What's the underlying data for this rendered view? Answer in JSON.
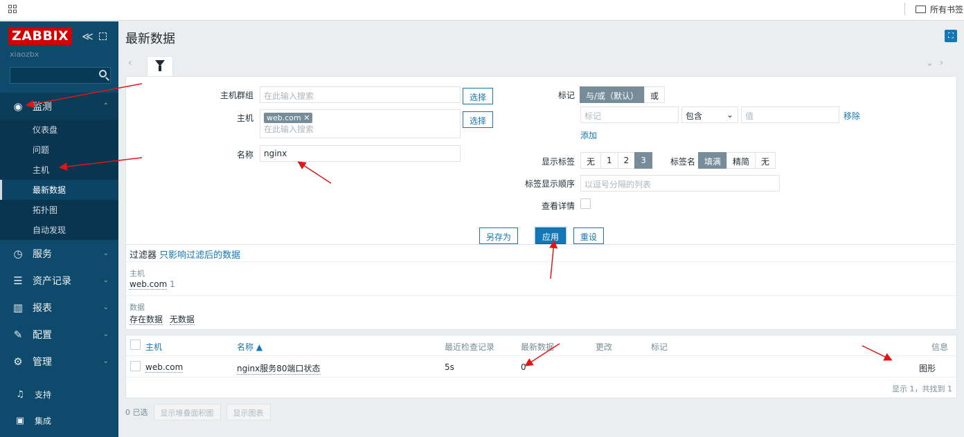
{
  "browser": {
    "bookmarks_label": "所有书签"
  },
  "sidebar": {
    "logo": "ZABBIX",
    "collapse": "≪",
    "server_name": "xiaozbx",
    "search_placeholder": "",
    "menu": [
      {
        "label": "监测",
        "icon": "eye-icon",
        "open": true
      },
      {
        "label": "服务",
        "icon": "clock-icon"
      },
      {
        "label": "资产记录",
        "icon": "list-icon"
      },
      {
        "label": "报表",
        "icon": "chart-icon"
      },
      {
        "label": "配置",
        "icon": "wrench-icon"
      },
      {
        "label": "管理",
        "icon": "gear-icon"
      }
    ],
    "submenu": [
      {
        "label": "仪表盘"
      },
      {
        "label": "问题"
      },
      {
        "label": "主机"
      },
      {
        "label": "最新数据",
        "active": true
      },
      {
        "label": "拓扑图"
      },
      {
        "label": "自动发现"
      }
    ],
    "bottom": [
      {
        "label": "支持",
        "icon": "headset-icon"
      },
      {
        "label": "集成",
        "icon": "z-icon"
      }
    ]
  },
  "page": {
    "title": "最新数据"
  },
  "filter": {
    "host_group_label": "主机群组",
    "host_group_placeholder": "在此输入搜索",
    "select_label": "选择",
    "host_label": "主机",
    "host_tag": "web.com",
    "host_placeholder": "在此输入搜索",
    "name_label": "名称",
    "name_value": "nginx",
    "tags_label": "标记",
    "and_or": "与/或（默认）",
    "or": "或",
    "tag_placeholder": "标记",
    "contains": "包含",
    "value_placeholder": "值",
    "remove": "移除",
    "add": "添加",
    "show_tags_label": "显示标签",
    "show_tags_options": [
      "无",
      "1",
      "2",
      "3"
    ],
    "tag_name_label": "标签名",
    "tag_name_options": [
      "填满",
      "精简",
      "无"
    ],
    "tag_priority_label": "标签显示顺序",
    "tag_priority_placeholder": "以逗号分隔的列表",
    "show_details_label": "查看详情",
    "save_as": "另存为",
    "apply": "应用",
    "reset": "重设"
  },
  "filter_info": {
    "title": "过滤器",
    "subtitle": "只影响过滤后的数据",
    "host_section": "主机",
    "host_value": "web.com",
    "host_count": "1",
    "data_section": "数据",
    "data_with": "存在数据",
    "data_without": "无数据"
  },
  "table": {
    "headers": {
      "host": "主机",
      "name": "名称 ▲",
      "last_check": "最近检查记录",
      "last_value": "最新数据",
      "change": "更改",
      "tags": "标记",
      "info": "信息"
    },
    "rows": [
      {
        "host": "web.com",
        "name": "nginx服务80端口状态",
        "last_check": "5s",
        "last_value": "0",
        "action": "图形"
      }
    ],
    "footer": "显示 1，共找到 1"
  },
  "actions": {
    "selected": "0 已选",
    "stacked_graph": "显示堆叠面积图",
    "graph": "显示图表"
  },
  "colors": {
    "sidebar": "#0e4a6b",
    "accent": "#1377b5",
    "logo": "#d40000",
    "annotation": "#e01515"
  }
}
